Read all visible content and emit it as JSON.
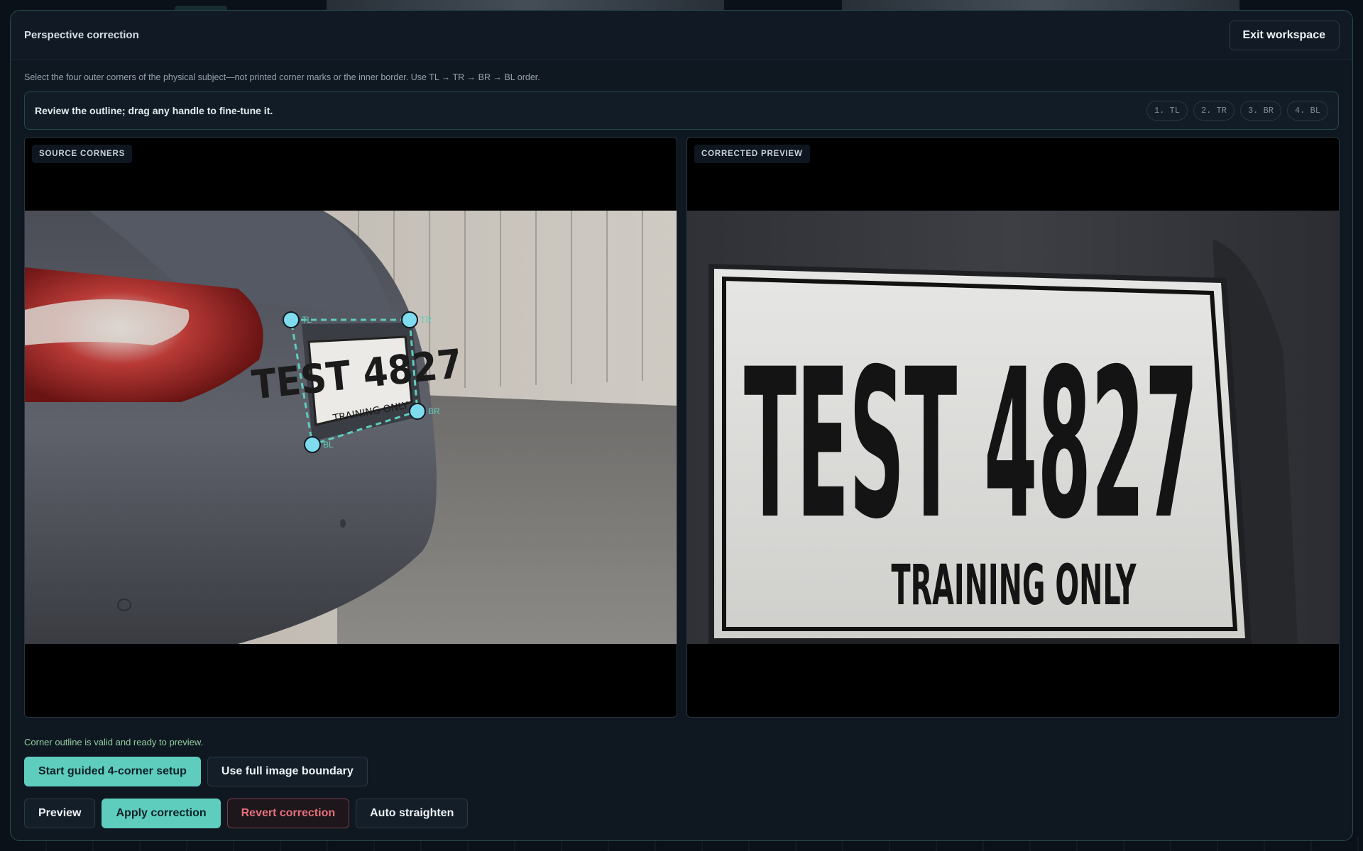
{
  "modal": {
    "title": "Perspective correction",
    "exit_label": "Exit workspace",
    "instructions": "Select the four outer corners of the physical subject—not printed corner marks or the inner border. Use TL → TR → BR → BL order.",
    "review_text": "Review the outline; drag any handle to fine-tune it.",
    "steps": [
      "1. TL",
      "2. TR",
      "3. BR",
      "4. BL"
    ]
  },
  "source_panel": {
    "label": "SOURCE CORNERS",
    "plate_line1": "TEST 4827",
    "plate_line2": "TRAINING ONLY",
    "handles": [
      "TL",
      "TR",
      "BR",
      "BL"
    ]
  },
  "preview_panel": {
    "label": "CORRECTED PREVIEW",
    "plate_line1": "TEST 4827",
    "plate_line2": "TRAINING ONLY"
  },
  "status": {
    "valid_message": "Corner outline is valid and ready to preview."
  },
  "actions": {
    "guided_setup": "Start guided 4-corner setup",
    "full_boundary": "Use full image boundary",
    "preview": "Preview",
    "apply": "Apply correction",
    "revert": "Revert correction",
    "auto_straighten": "Auto straighten"
  },
  "colors": {
    "accent": "#5ecdbd",
    "handle": "#7fdcee",
    "danger": "#e4717a",
    "valid": "#8fd0a0"
  }
}
